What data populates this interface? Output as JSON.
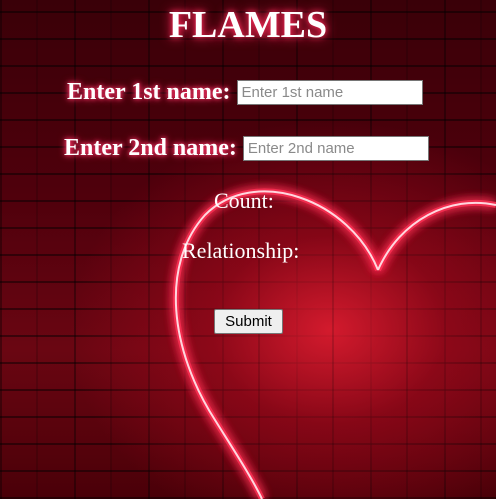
{
  "page": {
    "title": "FLAMES"
  },
  "form": {
    "first_name_label": "Enter 1st name:",
    "first_name_placeholder": "Enter 1st name",
    "first_name_value": "",
    "second_name_label": "Enter 2nd name:",
    "second_name_placeholder": "Enter 2nd name",
    "second_name_value": "",
    "submit_label": "Submit"
  },
  "result": {
    "count_label": "Count:",
    "relationship_label": "Relationship:"
  },
  "decor": {
    "background_image": "neon-heart-on-red-brick-wall",
    "heart_color": "#ff3355",
    "title_glow": "#ff2a5a"
  }
}
